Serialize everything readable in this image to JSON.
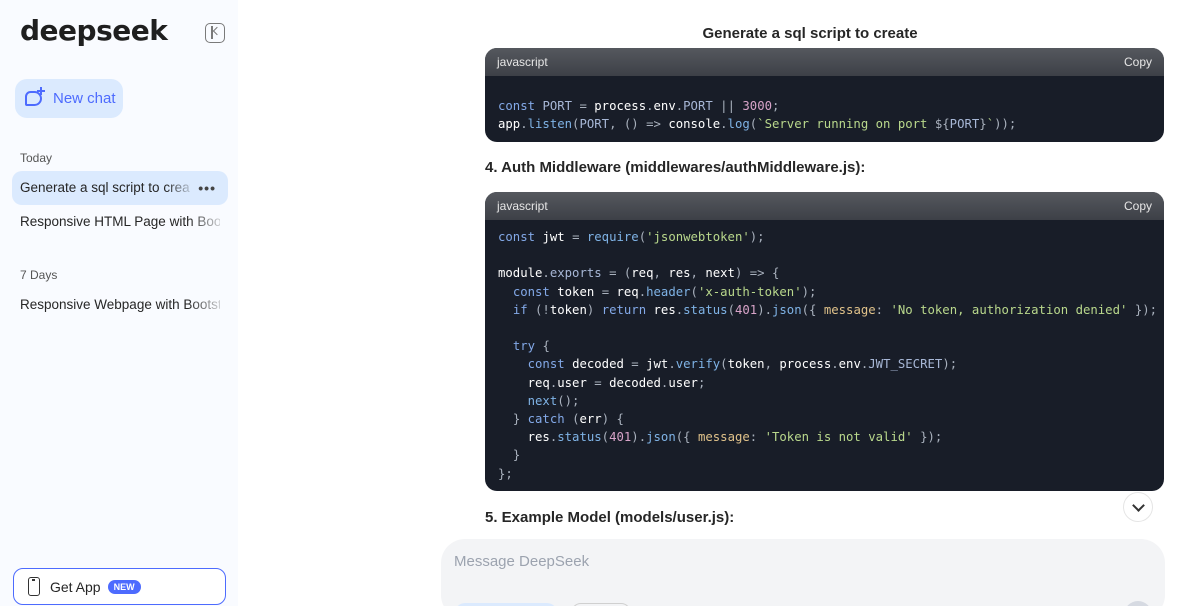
{
  "sidebar": {
    "logo": "deepseek",
    "new_chat_label": "New chat",
    "sections": [
      {
        "label": "Today",
        "items": [
          "Generate a sql script to create",
          "Responsive HTML Page with Bootstr"
        ]
      },
      {
        "label": "7 Days",
        "items": [
          "Responsive Webpage with Bootstrap"
        ]
      }
    ],
    "get_app_label": "Get App",
    "get_app_badge": "NEW"
  },
  "main": {
    "title": "Generate a sql script to create",
    "code_blocks": [
      {
        "language": "javascript",
        "copy_label": "Copy"
      },
      {
        "language": "javascript",
        "copy_label": "Copy"
      }
    ],
    "headings": [
      "4. Auth Middleware (middlewares/authMiddleware.js):",
      "5. Example Model (models/user.js):"
    ],
    "input_placeholder": "Message DeepSeek"
  },
  "colors": {
    "accent": "#4d6bfe",
    "sidebar_bg": "#f9fbff",
    "active_item_bg": "#dbeafe",
    "code_bg": "#181d28"
  }
}
